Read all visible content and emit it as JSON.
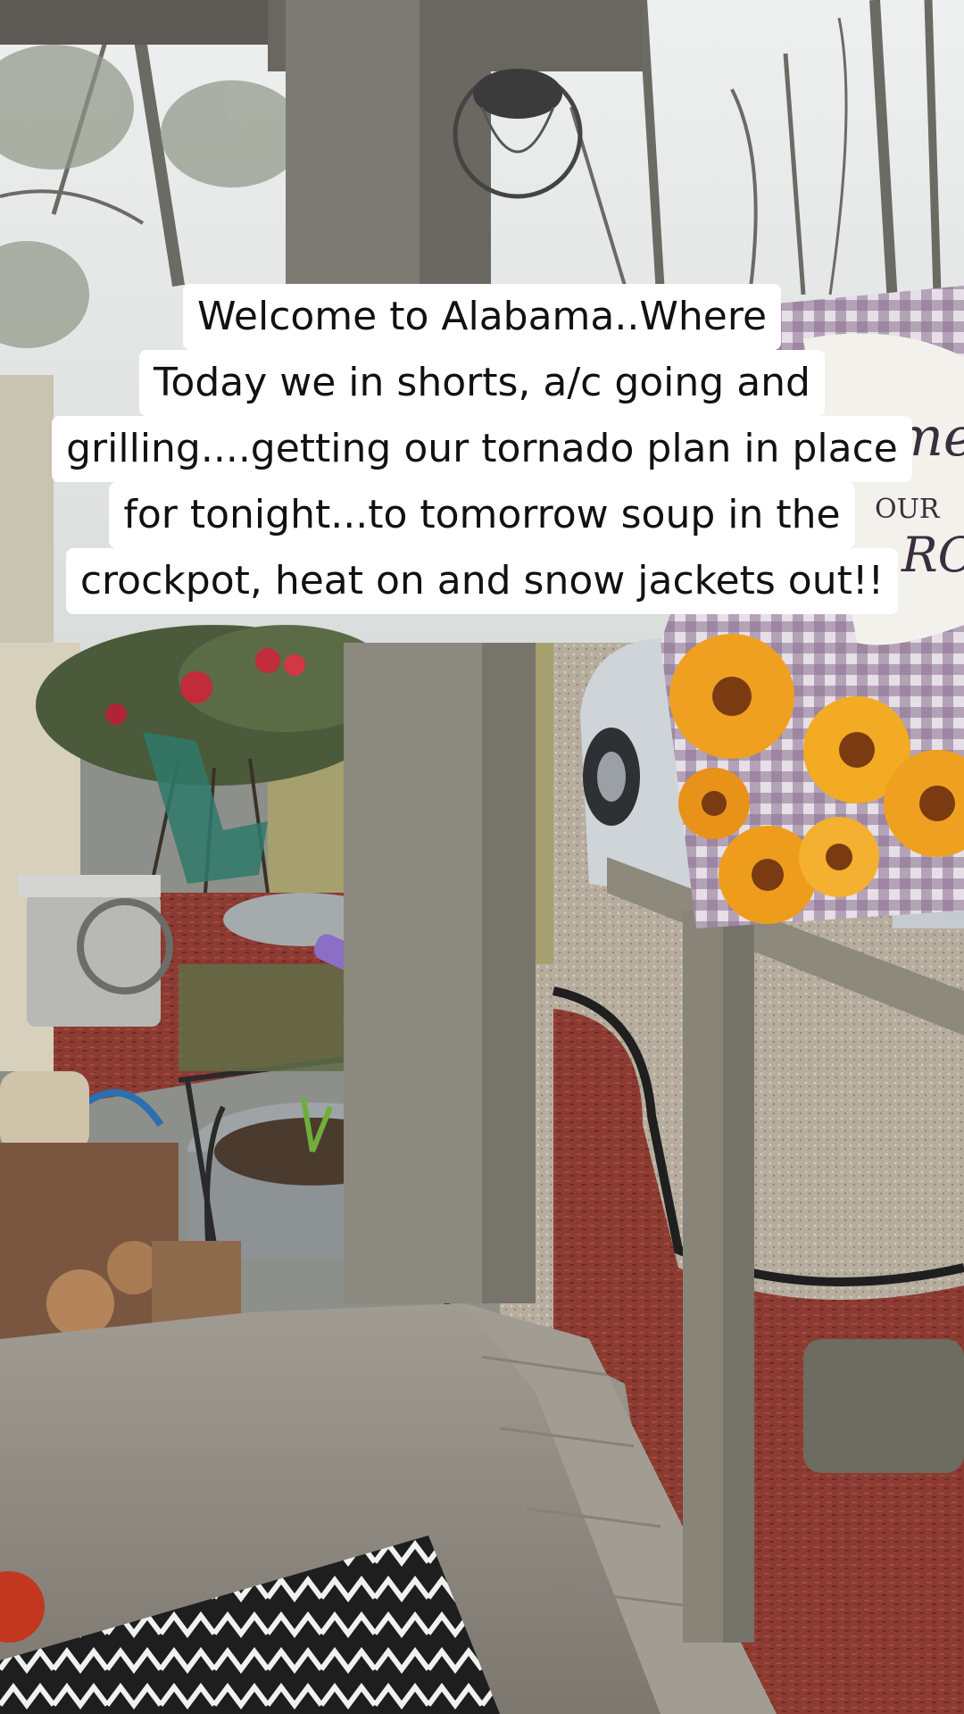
{
  "caption": {
    "lines": [
      "Welcome to Alabama..Where",
      "Today we in shorts, a/c going and",
      "grilling....getting our tornado plan in place",
      "for tonight...to tomorrow soup in the",
      "crockpot, heat on and snow jackets out!!"
    ]
  },
  "flag_text": {
    "line1": "me",
    "line2": "OUR",
    "line3": "RCH"
  },
  "colors": {
    "sky": "#e9ecec",
    "mulch": "#8a3a32",
    "post": "#8b8b82",
    "car": "#c9ced3",
    "sunflower": "#f0a020"
  }
}
